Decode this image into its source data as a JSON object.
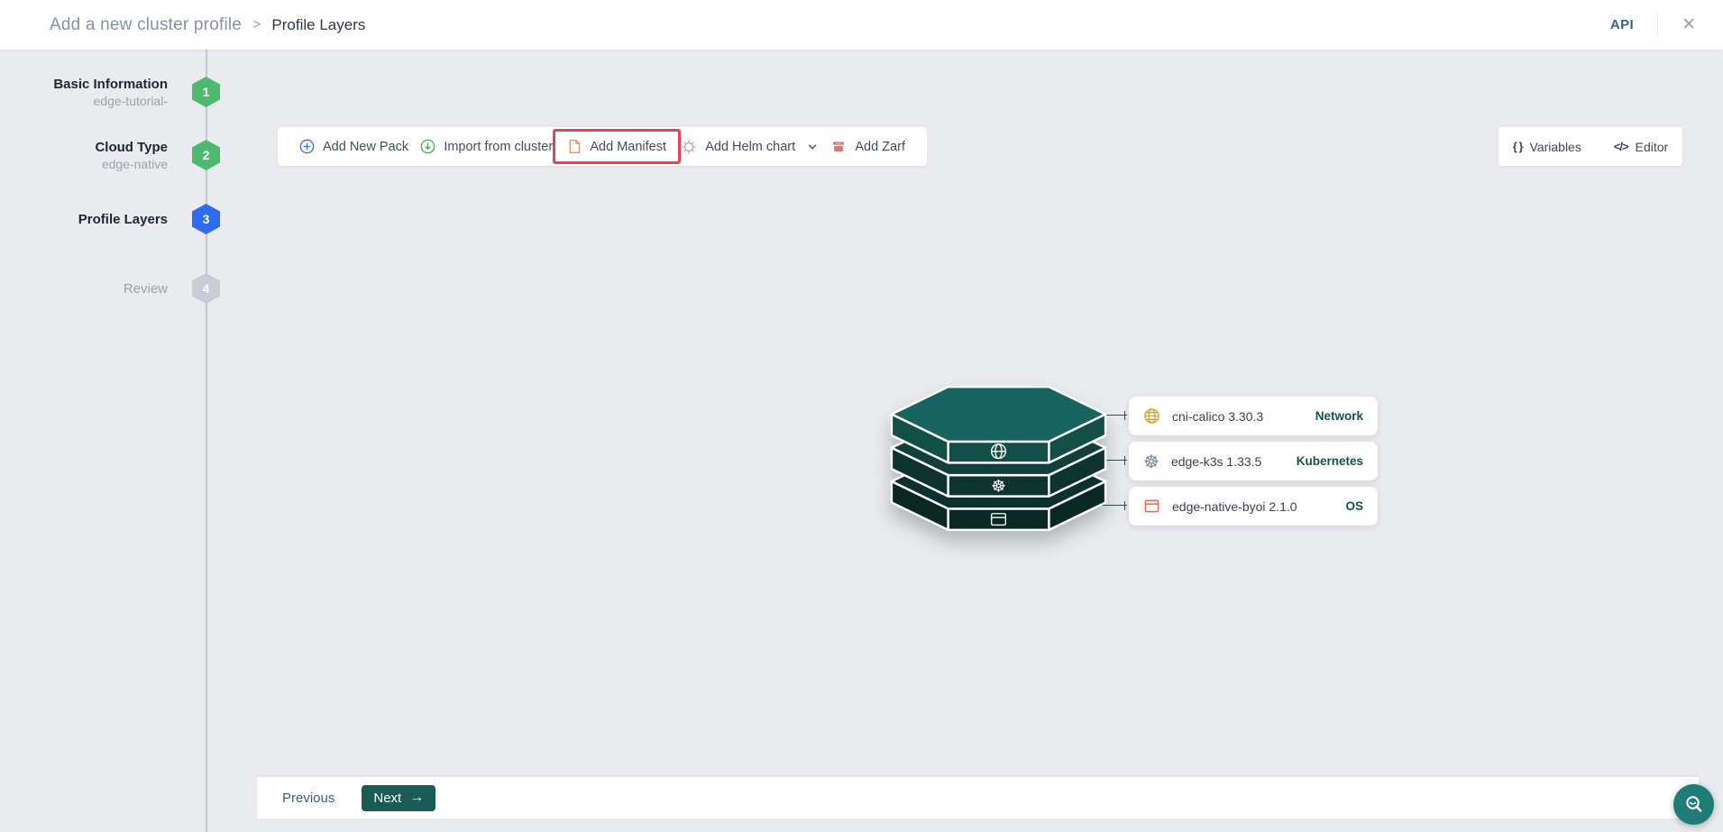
{
  "header": {
    "breadcrumb": {
      "parent": "Add a new cluster profile",
      "separator": ">",
      "current": "Profile Layers"
    },
    "api_label": "API",
    "close_glyph": "✕"
  },
  "stepper": {
    "steps": [
      {
        "number": "1",
        "label": "Basic Information",
        "sublabel": "edge-tutorial-",
        "state": "completed"
      },
      {
        "number": "2",
        "label": "Cloud Type",
        "sublabel": "edge-native",
        "state": "completed"
      },
      {
        "number": "3",
        "label": "Profile Layers",
        "sublabel": "",
        "state": "active"
      },
      {
        "number": "4",
        "label": "Review",
        "sublabel": "",
        "state": "upcoming"
      }
    ]
  },
  "toolbar": {
    "buttons": [
      {
        "label": "Add New Pack",
        "icon": "plus-circle-icon",
        "highlighted": false
      },
      {
        "label": "Import from cluster",
        "icon": "download-circle-icon",
        "highlighted": false
      },
      {
        "label": "Add Manifest",
        "icon": "manifest-file-icon",
        "highlighted": true
      },
      {
        "label": "Add Helm chart",
        "icon": "helm-wheel-icon",
        "dropdown": true,
        "highlighted": false
      },
      {
        "label": "Add Zarf",
        "icon": "zarf-icon",
        "highlighted": false
      }
    ]
  },
  "side_tools": {
    "variables": {
      "label": "Variables",
      "glyph": "{ }"
    },
    "editor": {
      "label": "Editor",
      "glyph": "</>"
    }
  },
  "stack": {
    "layers": [
      {
        "icon": "globe-icon",
        "top_color": "#17635d",
        "side_color": "#124f49"
      },
      {
        "icon": "kubernetes-wheel-icon",
        "glyph": "☸",
        "top_color": "#123f3c",
        "side_color": "#0e3431"
      },
      {
        "icon": "os-window-icon",
        "top_color": "#0d312e",
        "side_color": "#092824"
      }
    ]
  },
  "packs": [
    {
      "name": "cni-calico 3.30.3",
      "type": "Network",
      "icon": "globe-icon"
    },
    {
      "name": "edge-k3s 1.33.5",
      "type": "Kubernetes",
      "icon": "kubernetes-wheel-icon",
      "glyph": "☸"
    },
    {
      "name": "edge-native-byoi 2.1.0",
      "type": "OS",
      "icon": "os-window-icon"
    }
  ],
  "footer": {
    "previous_label": "Previous",
    "next_label": "Next",
    "next_arrow": "→"
  },
  "colors": {
    "background": "#e9ebee",
    "highlight_red": "#e8414f",
    "step_completed_green": "#4dba70",
    "step_active_blue": "#2e6bf0",
    "step_upcoming_gray": "#c7ccd6",
    "primary_teal_button": "#1a5c55",
    "help_button_teal": "#1e7e77",
    "pack_type_teal": "#14534d",
    "api_link_navy": "#41608c"
  }
}
